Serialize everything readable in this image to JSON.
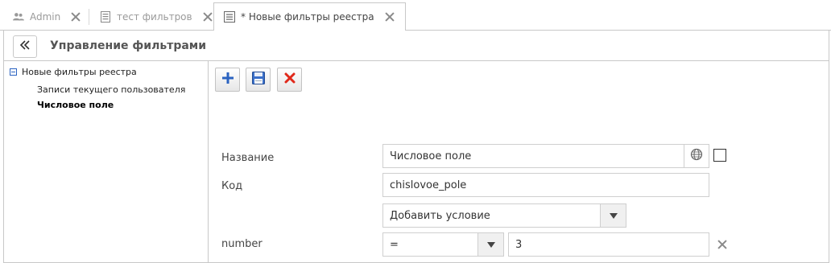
{
  "tabs": [
    {
      "label": "Admin",
      "icon": "users-icon",
      "active": false
    },
    {
      "label": "тест фильтров",
      "icon": "document-icon",
      "active": false
    },
    {
      "label": "* Новые фильтры реестра",
      "icon": "list-document-icon",
      "active": true
    }
  ],
  "header": {
    "collapse_icon": "double-chevron-left-icon",
    "title": "Управление фильтрами"
  },
  "tree": {
    "root": "Новые фильтры реестра",
    "children": [
      {
        "label": "Записи текущего пользователя",
        "selected": false
      },
      {
        "label": "Числовое поле",
        "selected": true
      }
    ]
  },
  "toolbar": {
    "add_icon": "plus-icon",
    "save_icon": "floppy-disk-icon",
    "delete_icon": "red-x-icon"
  },
  "form": {
    "name_label": "Название",
    "name_value": "Числовое поле",
    "globe_icon": "globe-icon",
    "code_label": "Код",
    "code_value": "chislovoe_pole",
    "add_condition": "Добавить условие",
    "condition": {
      "field": "number",
      "operator": "=",
      "value": "3"
    }
  },
  "colors": {
    "accent_blue": "#2b63c1",
    "delete_red": "#e0281a",
    "border": "#c8c8c8"
  }
}
